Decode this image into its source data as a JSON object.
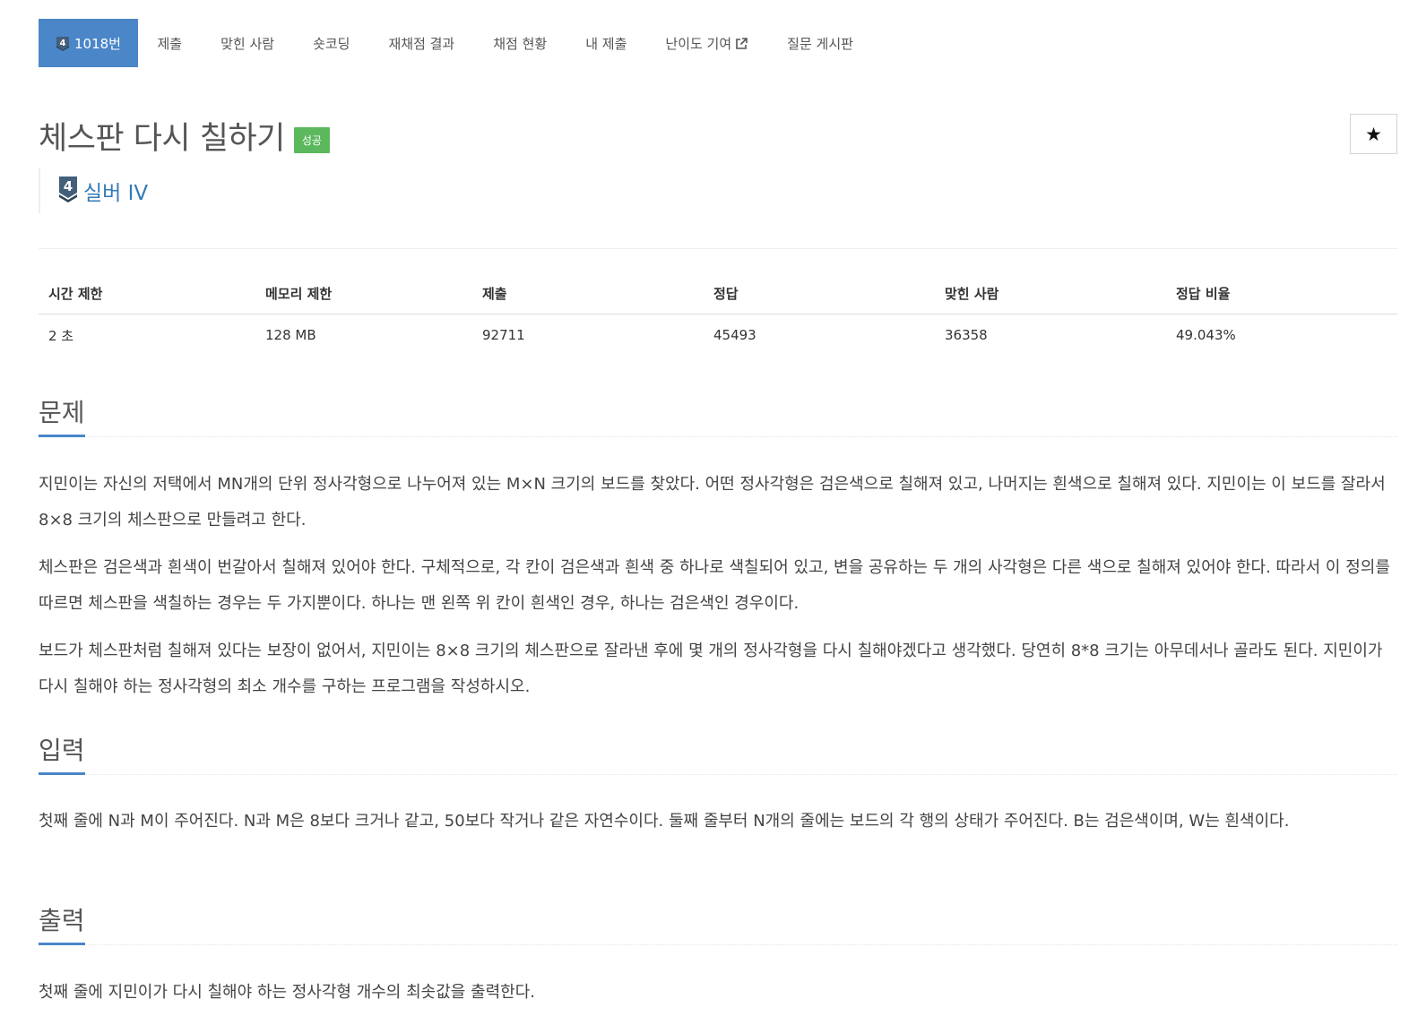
{
  "tabs": [
    {
      "label": "1018번",
      "tier": "4",
      "active": true
    },
    {
      "label": "제출"
    },
    {
      "label": "맞힌 사람"
    },
    {
      "label": "숏코딩"
    },
    {
      "label": "재채점 결과"
    },
    {
      "label": "채점 현황"
    },
    {
      "label": "내 제출"
    },
    {
      "label": "난이도 기여",
      "external": true
    },
    {
      "label": "질문 게시판"
    }
  ],
  "problem": {
    "title": "체스판 다시 칠하기",
    "status_badge": "성공",
    "star_icon": "★",
    "tier_number": "4",
    "tier_label": "실버 IV"
  },
  "info": {
    "headers": [
      "시간 제한",
      "메모리 제한",
      "제출",
      "정답",
      "맞힌 사람",
      "정답 비율"
    ],
    "values": [
      "2 초",
      "128 MB",
      "92711",
      "45493",
      "36358",
      "49.043%"
    ]
  },
  "sections": {
    "description": {
      "heading": "문제",
      "paragraphs": [
        "지민이는 자신의 저택에서 MN개의 단위 정사각형으로 나누어져 있는 M×N 크기의 보드를 찾았다. 어떤 정사각형은 검은색으로 칠해져 있고, 나머지는 흰색으로 칠해져 있다. 지민이는 이 보드를 잘라서 8×8 크기의 체스판으로 만들려고 한다.",
        "체스판은 검은색과 흰색이 번갈아서 칠해져 있어야 한다. 구체적으로, 각 칸이 검은색과 흰색 중 하나로 색칠되어 있고, 변을 공유하는 두 개의 사각형은 다른 색으로 칠해져 있어야 한다. 따라서 이 정의를 따르면 체스판을 색칠하는 경우는 두 가지뿐이다. 하나는 맨 왼쪽 위 칸이 흰색인 경우, 하나는 검은색인 경우이다.",
        "보드가 체스판처럼 칠해져 있다는 보장이 없어서, 지민이는 8×8 크기의 체스판으로 잘라낸 후에 몇 개의 정사각형을 다시 칠해야겠다고 생각했다. 당연히 8*8 크기는 아무데서나 골라도 된다. 지민이가 다시 칠해야 하는 정사각형의 최소 개수를 구하는 프로그램을 작성하시오."
      ]
    },
    "input": {
      "heading": "입력",
      "paragraphs": [
        "첫째 줄에 N과 M이 주어진다. N과 M은 8보다 크거나 같고, 50보다 작거나 같은 자연수이다. 둘째 줄부터 N개의 줄에는 보드의 각 행의 상태가 주어진다. B는 검은색이며, W는 흰색이다."
      ]
    },
    "output": {
      "heading": "출력",
      "paragraphs": [
        "첫째 줄에 지민이가 다시 칠해야 하는 정사각형 개수의 최솟값을 출력한다."
      ]
    }
  },
  "colors": {
    "accent": "#4a86c8",
    "success": "#5cb85c",
    "silver_tier": "#435f7a",
    "link": "#337ab7"
  },
  "icons": {
    "tier_badge": "silver-tier-shield-icon",
    "external_link": "external-link-icon",
    "bookmark": "star-icon"
  }
}
